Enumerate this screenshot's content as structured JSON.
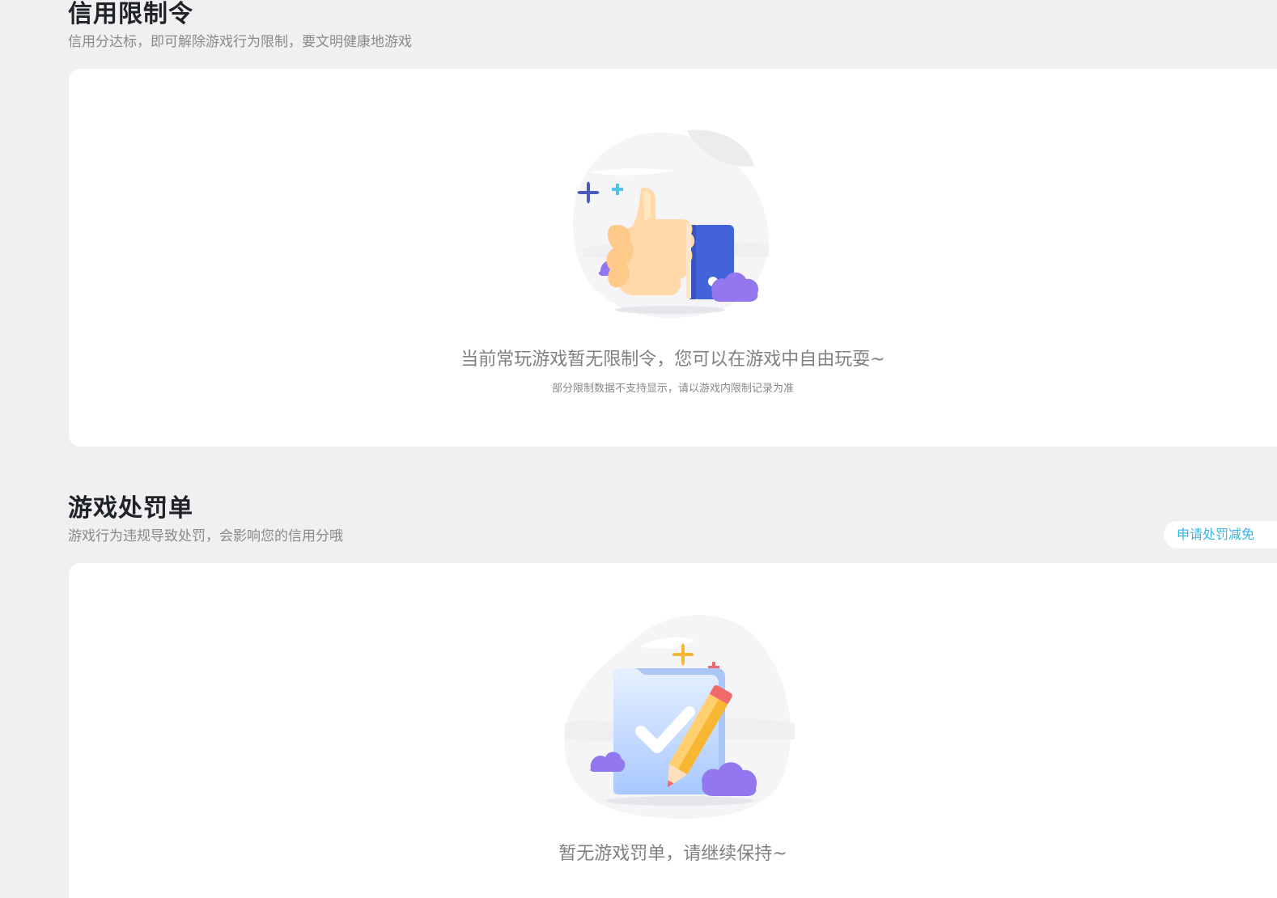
{
  "restriction_section": {
    "title": "信用限制令",
    "subtitle": "信用分达标，即可解除游戏行为限制，要文明健康地游戏",
    "empty_message": "当前常玩游戏暂无限制令，您可以在游戏中自由玩耍~",
    "note": "部分限制数据不支持显示，请以游戏内限制记录为准"
  },
  "penalty_section": {
    "title": "游戏处罚单",
    "subtitle": "游戏行为违规导致处罚，会影响您的信用分哦",
    "apply_button_label": "申请处罚减免",
    "empty_message": "暂无游戏罚单，请继续保持~"
  },
  "colors": {
    "page_background": "#f0f0f0",
    "card_background": "#ffffff",
    "accent": "#35b3e6",
    "title_text": "#1f2329",
    "muted_text": "#8a8a8a"
  },
  "icons": {
    "restriction_illustration": "thumbs-up-icon",
    "penalty_illustration": "checked-document-pencil-icon"
  }
}
